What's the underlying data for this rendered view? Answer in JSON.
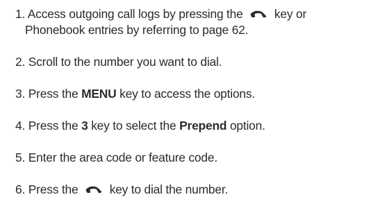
{
  "steps": [
    {
      "number": "1.",
      "line1_before_icon": "Access outgoing call logs by pressing the",
      "icon": "send-key-icon",
      "line1_after_icon": "key or",
      "line2": "Phonebook entries by referring to page 62."
    },
    {
      "number": "2.",
      "text": "Scroll to the number you want to dial."
    },
    {
      "number": "3.",
      "before": "Press the",
      "bold": "MENU",
      "after": "key to access the options."
    },
    {
      "number": "4.",
      "before": "Press the",
      "bold1": "3",
      "middle": "key to select the",
      "bold2": "Prepend",
      "after": "option."
    },
    {
      "number": "5.",
      "text": "Enter the area code or feature code."
    },
    {
      "number": "6.",
      "before": "Press the",
      "icon": "send-key-icon",
      "after": "key to dial the number."
    }
  ]
}
